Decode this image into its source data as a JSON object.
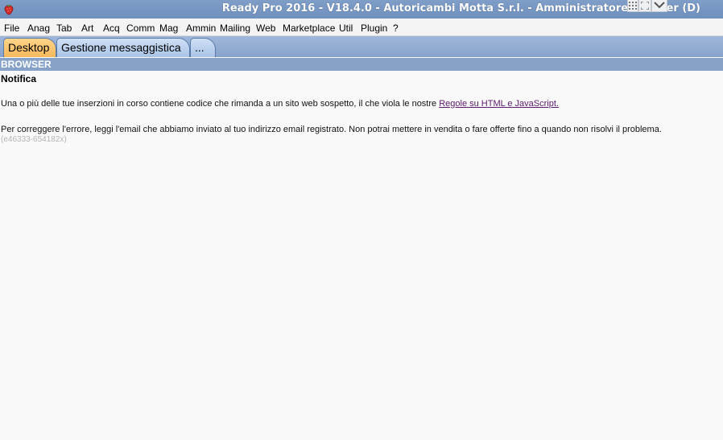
{
  "window": {
    "title": "Ready Pro 2016 - V18.4.0 - Autoricambi Motta S.r.l. - Amministratore - Server (D)",
    "app_icon": "strawberry-icon",
    "controls": [
      "grid-icon",
      "expand-icon",
      "chevron-down-icon"
    ]
  },
  "menu": {
    "items": [
      "File",
      "Anag",
      "Tab",
      "Art",
      "Acq",
      "Comm",
      "Mag",
      "Ammin",
      "Mailing",
      "Web",
      "Marketplace",
      "Util",
      "Plugin",
      "?"
    ]
  },
  "tabs": [
    {
      "label": "Desktop",
      "active": true
    },
    {
      "label": "Gestione messaggistica",
      "active": false
    },
    {
      "label": "...",
      "active": false
    }
  ],
  "browser": {
    "header": "BROWSER",
    "notification": {
      "title": "Notifica",
      "line1_prefix": "Una o più delle tue inserzioni in corso contiene codice che rimanda a un sito web sospetto, il che viola le nostre ",
      "line1_link": "Regole su HTML e JavaScript.",
      "line2": "Per correggere l'errore, leggi l'email che abbiamo inviato al tuo indirizzo email registrato. Non potrai mettere in vendita o fare offerte fino a quando non risolvi il problema.",
      "error_code": "(e46333-654182x)"
    }
  },
  "colors": {
    "titlebar": "#7896c3",
    "active_tab": "#f6b95a",
    "inactive_tab": "#bcd2ee",
    "browser_header": "#86a2c9",
    "link": "#5b1a6b"
  }
}
